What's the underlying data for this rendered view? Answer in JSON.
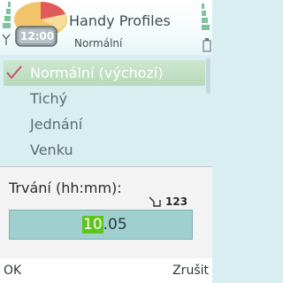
{
  "header": {
    "app_title": "Handy Profiles",
    "current_profile": "Normální",
    "app_icon": "pie-chart-clock-icon",
    "clock_display": "12:00",
    "signal_icon": "antenna-icon"
  },
  "profiles": {
    "items": [
      {
        "label": "Normální (výchozí)",
        "selected": true
      },
      {
        "label": "Tichý",
        "selected": false
      },
      {
        "label": "Jednání",
        "selected": false
      },
      {
        "label": "Venku",
        "selected": false
      }
    ]
  },
  "query": {
    "label": "Trvání (hh:mm):",
    "input_mode": "123",
    "hours": "10",
    "minutes": ".05"
  },
  "softkeys": {
    "left": "OK",
    "right": "Zrušit"
  },
  "colors": {
    "accent_green": "#5cc51a",
    "field_teal": "#9fcfcf",
    "background": "#d8eef0"
  }
}
